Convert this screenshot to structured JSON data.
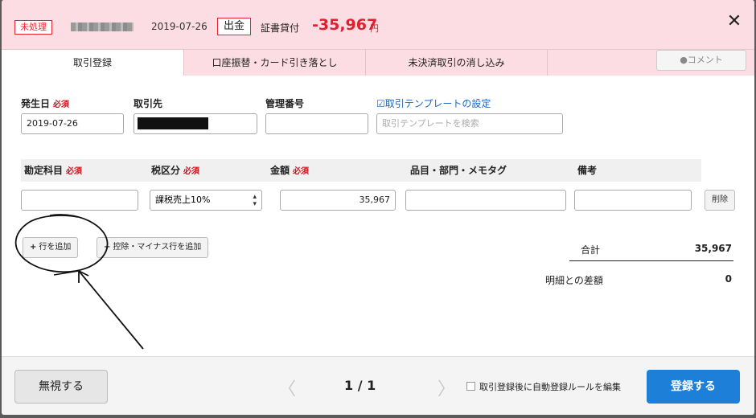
{
  "header": {
    "status_badge": "未処理",
    "date": "2019-07-26",
    "direction_badge": "出金",
    "type": "証書貸付",
    "amount": "-35,967",
    "currency": "円",
    "close_icon": "close-icon"
  },
  "tabs": [
    {
      "label": "取引登録",
      "active": true
    },
    {
      "label": "口座振替・カード引き落とし",
      "active": false
    },
    {
      "label": "未決済取引の消し込み",
      "active": false
    }
  ],
  "comment_button": "●コメント",
  "form": {
    "date_label": "発生日",
    "required": "必須",
    "date_value": "2019-07-26",
    "partner_label": "取引先",
    "mgmt_label": "管理番号",
    "template_link": "☑取引テンプレートの設定",
    "template_placeholder": "取引テンプレートを検索"
  },
  "table": {
    "headers": {
      "account": "勘定科目",
      "tax": "税区分",
      "amount": "金額",
      "item": "品目・部門・メモタグ",
      "memo": "備考"
    },
    "row": {
      "account": "",
      "tax": "課税売上10%",
      "amount": "35,967",
      "item": "",
      "memo": "",
      "delete": "削除"
    }
  },
  "buttons": {
    "add_row": "行を追加",
    "add_deduction": "控除・マイナス行を追加",
    "plus": "+"
  },
  "totals": {
    "total_label": "合計",
    "total_value": "35,967",
    "diff_label": "明細との差額",
    "diff_value": "0"
  },
  "footer": {
    "ignore": "無視する",
    "prev": "〈",
    "page": "1 / 1",
    "next": "〉",
    "auto_rule": "取引登録後に自動登録ルールを編集",
    "submit": "登録する"
  }
}
